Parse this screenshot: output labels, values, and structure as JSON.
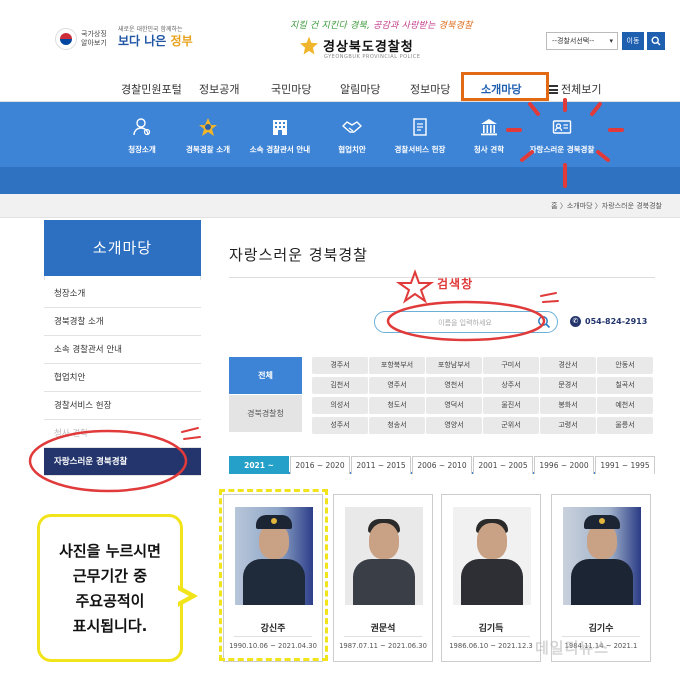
{
  "header": {
    "gov_logo_text": "국가상징 알아보기",
    "better_gov_small": "새로운 대한민국 함께하는",
    "better_gov_main_a": "보다 나은 ",
    "better_gov_main_b": "정부",
    "slogan_1": "지킬 건 지킨다 경북,",
    "slogan_2": "공감과 사랑받는 ",
    "slogan_3": "경북경찰",
    "agency_title": "경상북도경찰청",
    "agency_sub": "GYEONGBUK PROVINCIAL POLICE",
    "station_select": "--경찰서선택--",
    "move_label": "이동",
    "search_icon": "search-icon"
  },
  "gnb": {
    "items": [
      "경찰민원포털",
      "정보공개",
      "국민마당",
      "알림마당",
      "정보마당",
      "소개마당",
      "전체보기"
    ],
    "active_index": 5
  },
  "submenu": {
    "items": [
      {
        "label": "청장소개",
        "icon": "person-icon"
      },
      {
        "label": "경북경찰 소개",
        "icon": "police-emblem-icon"
      },
      {
        "label": "소속 경찰관서 안내",
        "icon": "building-icon"
      },
      {
        "label": "협업치안",
        "icon": "handshake-icon"
      },
      {
        "label": "경찰서비스 헌장",
        "icon": "document-icon"
      },
      {
        "label": "청사 견학",
        "icon": "government-building-icon"
      },
      {
        "label": "자랑스러운 경북경찰",
        "icon": "id-card-icon"
      }
    ]
  },
  "breadcrumb": "홈 〉소개마당 〉자랑스러운 경북경찰",
  "lnb": {
    "title": "소개마당",
    "items": [
      "청장소개",
      "경북경찰 소개",
      "소속 경찰관서 안내",
      "협업치안",
      "경찰서비스 헌장",
      "청사 견학",
      "자랑스러운 경북경찰"
    ],
    "active_index": 6
  },
  "content": {
    "title": "자랑스러운 경북경찰",
    "search_annotation": "검색창",
    "search_placeholder": "이름을 입력하세요",
    "phone": "054-824-2913",
    "filter_all": "전체",
    "filter_hq": "경북경찰청",
    "stations": [
      [
        "경주서",
        "포항북부서",
        "포항남부서",
        "구미서",
        "경산서",
        "안동서"
      ],
      [
        "김천서",
        "영주서",
        "영천서",
        "상주서",
        "문경서",
        "칠곡서"
      ],
      [
        "의성서",
        "청도서",
        "영덕서",
        "울진서",
        "봉화서",
        "예천서"
      ],
      [
        "성주서",
        "청송서",
        "영양서",
        "군위서",
        "고령서",
        "울릉서"
      ]
    ],
    "year_tabs": [
      "2021 ~",
      "2016 ~ 2020",
      "2011 ~ 2015",
      "2006 ~ 2010",
      "2001 ~ 2005",
      "1996 ~ 2000",
      "1991 ~ 1995"
    ],
    "cards": [
      {
        "name": "강신주",
        "period": "1990.10.06 ~ 2021.04.30"
      },
      {
        "name": "권문석",
        "period": "1987.07.11 ~ 2021.06.30"
      },
      {
        "name": "김기득",
        "period": "1986.06.10 ~ 2021.12.3"
      },
      {
        "name": "김기수",
        "period": "1984.11.14 ~ 2021.1"
      }
    ]
  },
  "callout": "사진을 누르시면\n근무기간 중\n주요공적이\n표시됩니다.",
  "watermark": "데일리뉴스",
  "colors": {
    "brand_blue": "#3d84d6",
    "navy": "#23356c",
    "highlight_orange": "#e26a14",
    "annotation_red": "#e03a3a",
    "annotation_yellow": "#f2e41b"
  }
}
